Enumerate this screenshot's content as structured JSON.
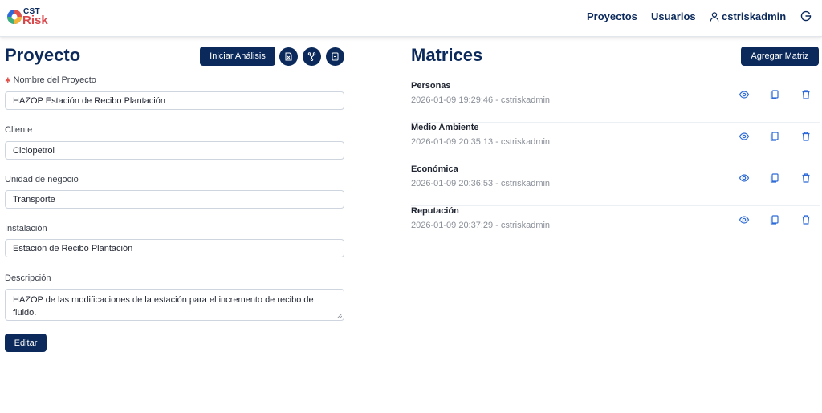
{
  "nav": {
    "logo_top": "CST",
    "logo_bottom": "Risk",
    "links": [
      "Proyectos",
      "Usuarios"
    ],
    "user": "cstriskadmin"
  },
  "project": {
    "title": "Proyecto",
    "analyze_label": "Iniciar Análisis",
    "fields": {
      "name_label": "Nombre del Proyecto",
      "name_value": "HAZOP Estación de Recibo Plantación",
      "client_label": "Cliente",
      "client_value": "Ciclopetrol",
      "unit_label": "Unidad de negocio",
      "unit_value": "Transporte",
      "installation_label": "Instalación",
      "installation_value": "Estación de Recibo Plantación",
      "description_label": "Descripción",
      "description_value": "HAZOP de las modificaciones de la estación para el incremento de recibo de fluido."
    },
    "edit_label": "Editar"
  },
  "matrices": {
    "title": "Matrices",
    "add_label": "Agregar Matriz",
    "items": [
      {
        "name": "Personas",
        "meta": "2026-01-09 19:29:46 - cstriskadmin"
      },
      {
        "name": "Medio Ambiente",
        "meta": "2026-01-09 20:35:13 - cstriskadmin"
      },
      {
        "name": "Económica",
        "meta": "2026-01-09 20:36:53 - cstriskadmin"
      },
      {
        "name": "Reputación",
        "meta": "2026-01-09 20:37:29 - cstriskadmin"
      }
    ]
  },
  "colors": {
    "primary": "#0b2a5b",
    "accent": "#d9474b",
    "icon_blue": "#2f6bd8"
  }
}
